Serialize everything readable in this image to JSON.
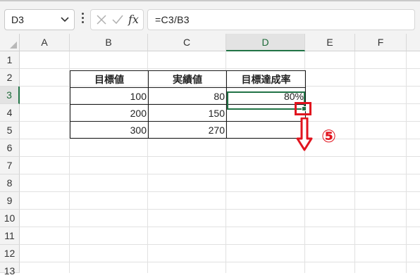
{
  "formula_bar": {
    "name_box": "D3",
    "formula": "=C3/B3",
    "fx_label": "fx",
    "icons": [
      "chevron-down-icon",
      "more-options-icon",
      "cancel-x-icon",
      "confirm-check-icon",
      "fx-icon"
    ]
  },
  "sheet": {
    "columns": [
      "A",
      "B",
      "C",
      "D",
      "E",
      "F"
    ],
    "rows": [
      "1",
      "2",
      "3",
      "4",
      "5",
      "6",
      "7",
      "8",
      "9",
      "10",
      "11",
      "12",
      "13"
    ],
    "selected_column": "D",
    "selected_row": "3"
  },
  "table": {
    "headers": [
      "目標値",
      "実績値",
      "目標達成率"
    ],
    "rows": [
      [
        "100",
        "80",
        "80%"
      ],
      [
        "200",
        "150",
        ""
      ],
      [
        "300",
        "270",
        ""
      ]
    ]
  },
  "annotation": {
    "step": "⑤",
    "color": "#e1141e"
  },
  "colors": {
    "selection": "#217346",
    "header_bg": "#f3f3f3",
    "annotation_red": "#e1141e"
  }
}
